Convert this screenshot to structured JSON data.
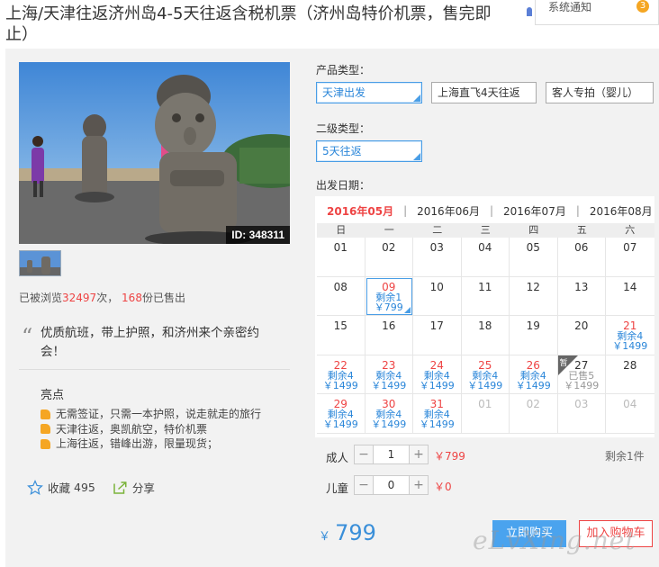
{
  "title": "上海/天津往返济州岛4-5天往返含税机票（济州岛特价机票，售完即止）",
  "notification": {
    "label": "系统通知",
    "count": "3"
  },
  "gallery": {
    "image_id": "ID: 348311"
  },
  "stats": {
    "viewed_prefix": "已被浏览",
    "views": "32497",
    "viewed_suffix": "次，",
    "sold": "168",
    "sold_suffix": "份已售出"
  },
  "description": "优质航班，带上护照，和济州来个亲密约会！",
  "highlights": {
    "title": "亮点",
    "items": [
      "无需签证，只需一本护照，说走就走的旅行",
      "天津往返，奥凯航空，特价机票",
      "上海往返，错峰出游，限量现货；"
    ]
  },
  "actions": {
    "favorite_label": "收藏",
    "favorite_count": "495",
    "share_label": "分享"
  },
  "product_type": {
    "label": "产品类型：",
    "options": [
      {
        "label": "天津出发",
        "selected": true
      },
      {
        "label": "上海直飞4天往返",
        "selected": false
      },
      {
        "label": "客人专拍（婴儿）",
        "selected": false
      }
    ]
  },
  "secondary_type": {
    "label": "二级类型：",
    "options": [
      {
        "label": "5天往返",
        "selected": true
      }
    ]
  },
  "departure": {
    "label": "出发日期："
  },
  "calendar": {
    "months": [
      "2016年05月",
      "2016年06月",
      "2016年07月",
      "2016年08月"
    ],
    "active_month": 0,
    "weekdays": [
      "日",
      "一",
      "二",
      "三",
      "四",
      "五",
      "六"
    ],
    "weeks": [
      [
        {
          "d": "01"
        },
        {
          "d": "02"
        },
        {
          "d": "03"
        },
        {
          "d": "04"
        },
        {
          "d": "05"
        },
        {
          "d": "06"
        },
        {
          "d": "07"
        }
      ],
      [
        {
          "d": "08"
        },
        {
          "d": "09",
          "l1": "剩余1",
          "l2": "￥799",
          "red": true,
          "selected": true
        },
        {
          "d": "10"
        },
        {
          "d": "11"
        },
        {
          "d": "12"
        },
        {
          "d": "13"
        },
        {
          "d": "14"
        }
      ],
      [
        {
          "d": "15"
        },
        {
          "d": "16"
        },
        {
          "d": "17"
        },
        {
          "d": "18"
        },
        {
          "d": "19"
        },
        {
          "d": "20"
        },
        {
          "d": "21",
          "l1": "剩余4",
          "l2": "￥1499",
          "red": true
        }
      ],
      [
        {
          "d": "22",
          "l1": "剩余4",
          "l2": "￥1499",
          "red": true
        },
        {
          "d": "23",
          "l1": "剩余4",
          "l2": "￥1499",
          "red": true
        },
        {
          "d": "24",
          "l1": "剩余4",
          "l2": "￥1499",
          "red": true
        },
        {
          "d": "25",
          "l1": "剩余4",
          "l2": "￥1499",
          "red": true
        },
        {
          "d": "26",
          "l1": "剩余4",
          "l2": "￥1499",
          "red": true
        },
        {
          "d": "27",
          "l1": "已售5",
          "l2": "￥1499",
          "soldout": true,
          "corner": "暂"
        },
        {
          "d": "28"
        }
      ],
      [
        {
          "d": "29",
          "l1": "剩余4",
          "l2": "￥1499",
          "red": true
        },
        {
          "d": "30",
          "l1": "剩余4",
          "l2": "￥1499",
          "red": true
        },
        {
          "d": "31",
          "l1": "剩余4",
          "l2": "￥1499",
          "red": true
        },
        {
          "d": "01",
          "muted": true
        },
        {
          "d": "02",
          "muted": true
        },
        {
          "d": "03",
          "muted": true
        },
        {
          "d": "04",
          "muted": true
        }
      ]
    ]
  },
  "quantity": {
    "adult": {
      "label": "成人",
      "value": "1",
      "price": "￥799"
    },
    "child": {
      "label": "儿童",
      "value": "0",
      "price": "￥0"
    },
    "remaining": "剩余1件"
  },
  "price": {
    "currency": "￥",
    "amount": "799"
  },
  "buttons": {
    "buy": "立即购买",
    "cart": "加入购物车"
  },
  "watermark": "eLvXing.net",
  "colors": {
    "accent": "#4aa3ee",
    "price_red": "#ee4444",
    "panel_bg": "#f2f2f2"
  }
}
